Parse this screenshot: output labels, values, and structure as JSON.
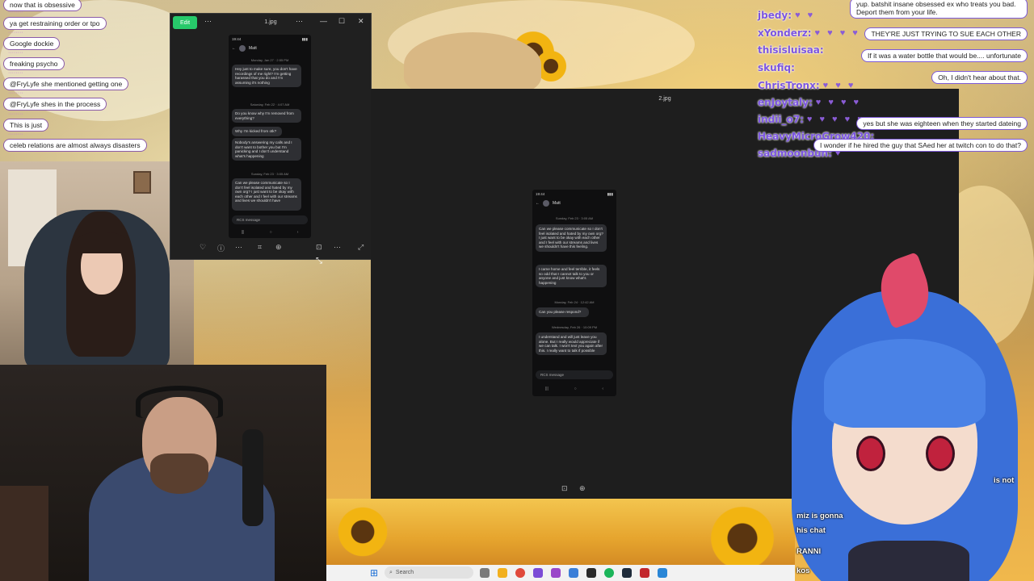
{
  "chat_left": [
    {
      "text": "now that is obsessive"
    },
    {
      "text": "ya get restraining order or tpo"
    },
    {
      "text": "Google dockie"
    },
    {
      "text": "freaking psycho"
    },
    {
      "text": "@FryLyfe she mentioned getting one"
    },
    {
      "text": "@FryLyfe shes in the process"
    },
    {
      "text": "This is just"
    },
    {
      "text": "celeb relations are almost always disasters"
    }
  ],
  "chat_right": {
    "rows": [
      {
        "user": "jbedy:",
        "hearts": "♥ ♥"
      },
      {
        "user": "xYonderz:",
        "hearts": "♥ ♥ ♥ ♥ ♥"
      },
      {
        "user": "thisisluisaa:",
        "hearts": ""
      },
      {
        "user": "skufiq:",
        "hearts": ""
      },
      {
        "user": "ChrisTronx:",
        "hearts": "♥ ♥ ♥"
      },
      {
        "user": "enJoytaly:",
        "hearts": "♥ ♥ ♥ ♥"
      },
      {
        "user": "indii_o7:",
        "hearts": "♥ ♥ ♥ ♥ ♥"
      },
      {
        "user": "HeavyMicroGrow420:",
        "hearts": ""
      },
      {
        "user": "sadmoonbun:",
        "hearts": "♥"
      }
    ],
    "bubbles": [
      "yup. batshit insane obsessed ex who treats you bad. Deport them from your life.",
      "THEY'RE JUST TRYING TO SUE EACH OTHER",
      "If it was a water bottle that would be.... unfortunate",
      "Oh, I didn't hear about that.",
      "yes but she was eighteen when they started dateing",
      "I wonder if he hired the guy that SAed her at twitch con to do that?"
    ]
  },
  "viewer1": {
    "title": "1.jpg",
    "edit_label": "Edit",
    "phone": {
      "time": "19:44",
      "contact": "Matt",
      "date1": "Monday, Jan 27 · 2:55 PM",
      "msg1": "Hey just to make sure, you don't have recordings of me right? I'm getting harassed that you do and I'm assuming it's nothing",
      "date2": "Saturday, Feb 22 · 4:07 AM",
      "msg2": "Do you know why I'm removed from everything?",
      "msg3": "Why I'm kicked from otk?",
      "msg4": "Nobody's answering my calls and I don't want to bother you but I'm panicking and I don't understand what's happening",
      "date3": "Sunday, Feb 23 · 3:05 AM",
      "msg5": "Can we please communicate so I don't feel isolated and hated by my own org? I just want to be okay with each other and I feel with our streams and lives we shouldn't have",
      "compose": "RCS message"
    }
  },
  "viewer2": {
    "title": "2.jpg",
    "phone": {
      "time": "19:44",
      "contact": "Matt",
      "date1": "Sunday, Feb 23 · 3:05 AM",
      "msg1": "Can we please communicate so I don't feel isolated and hated by my own org? I just want to be okay with each other and I feel with our streams and lives we shouldn't have this feeling.",
      "msg2": "I came home and feel terrible, it feels so odd that I cannot talk to you or anyone and just know what's happening",
      "date2": "Monday, Feb 24 · 12:42 AM",
      "msg3": "Can you please respond?",
      "date3": "Wednesday, Feb 26 · 10:09 PM",
      "msg4": "I understand and will just leave you alone. But I really would appreciate if we can talk. I won't text you again after this. I really want to talk if possible",
      "compose": "RCS message"
    }
  },
  "taskbar": {
    "search_placeholder": "Search"
  },
  "vtuber_chat": [
    "is not",
    "miz is gonna",
    "his chat",
    "RANNI",
    "kos"
  ],
  "colors": {
    "chat_user": "#7b55e0",
    "edit_button": "#27c96a",
    "viewer_bg": "#1e1e1e"
  }
}
